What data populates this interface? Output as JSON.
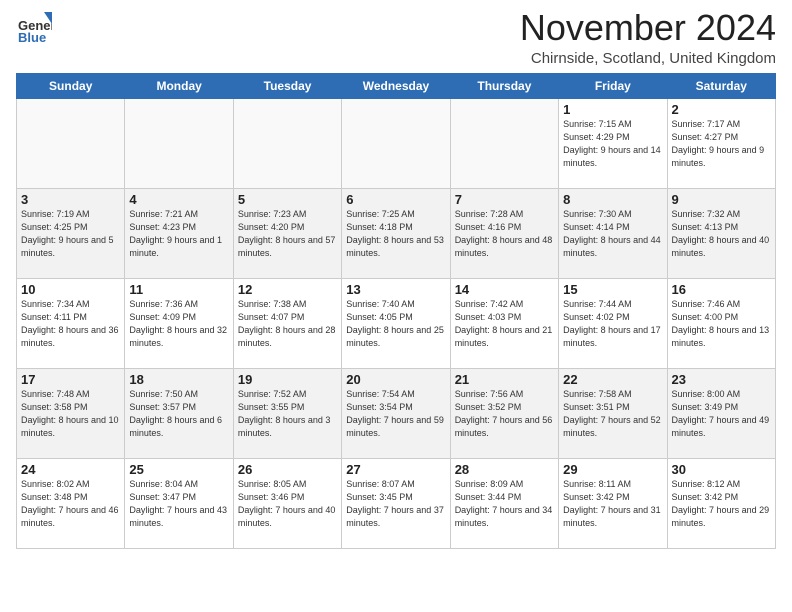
{
  "header": {
    "logo": {
      "general": "General",
      "blue": "Blue"
    },
    "title": "November 2024",
    "location": "Chirnside, Scotland, United Kingdom"
  },
  "weekdays": [
    "Sunday",
    "Monday",
    "Tuesday",
    "Wednesday",
    "Thursday",
    "Friday",
    "Saturday"
  ],
  "weeks": [
    [
      {
        "day": "",
        "empty": true
      },
      {
        "day": "",
        "empty": true
      },
      {
        "day": "",
        "empty": true
      },
      {
        "day": "",
        "empty": true
      },
      {
        "day": "",
        "empty": true
      },
      {
        "day": "1",
        "sunrise": "Sunrise: 7:15 AM",
        "sunset": "Sunset: 4:29 PM",
        "daylight": "Daylight: 9 hours and 14 minutes."
      },
      {
        "day": "2",
        "sunrise": "Sunrise: 7:17 AM",
        "sunset": "Sunset: 4:27 PM",
        "daylight": "Daylight: 9 hours and 9 minutes."
      }
    ],
    [
      {
        "day": "3",
        "sunrise": "Sunrise: 7:19 AM",
        "sunset": "Sunset: 4:25 PM",
        "daylight": "Daylight: 9 hours and 5 minutes."
      },
      {
        "day": "4",
        "sunrise": "Sunrise: 7:21 AM",
        "sunset": "Sunset: 4:23 PM",
        "daylight": "Daylight: 9 hours and 1 minute."
      },
      {
        "day": "5",
        "sunrise": "Sunrise: 7:23 AM",
        "sunset": "Sunset: 4:20 PM",
        "daylight": "Daylight: 8 hours and 57 minutes."
      },
      {
        "day": "6",
        "sunrise": "Sunrise: 7:25 AM",
        "sunset": "Sunset: 4:18 PM",
        "daylight": "Daylight: 8 hours and 53 minutes."
      },
      {
        "day": "7",
        "sunrise": "Sunrise: 7:28 AM",
        "sunset": "Sunset: 4:16 PM",
        "daylight": "Daylight: 8 hours and 48 minutes."
      },
      {
        "day": "8",
        "sunrise": "Sunrise: 7:30 AM",
        "sunset": "Sunset: 4:14 PM",
        "daylight": "Daylight: 8 hours and 44 minutes."
      },
      {
        "day": "9",
        "sunrise": "Sunrise: 7:32 AM",
        "sunset": "Sunset: 4:13 PM",
        "daylight": "Daylight: 8 hours and 40 minutes."
      }
    ],
    [
      {
        "day": "10",
        "sunrise": "Sunrise: 7:34 AM",
        "sunset": "Sunset: 4:11 PM",
        "daylight": "Daylight: 8 hours and 36 minutes."
      },
      {
        "day": "11",
        "sunrise": "Sunrise: 7:36 AM",
        "sunset": "Sunset: 4:09 PM",
        "daylight": "Daylight: 8 hours and 32 minutes."
      },
      {
        "day": "12",
        "sunrise": "Sunrise: 7:38 AM",
        "sunset": "Sunset: 4:07 PM",
        "daylight": "Daylight: 8 hours and 28 minutes."
      },
      {
        "day": "13",
        "sunrise": "Sunrise: 7:40 AM",
        "sunset": "Sunset: 4:05 PM",
        "daylight": "Daylight: 8 hours and 25 minutes."
      },
      {
        "day": "14",
        "sunrise": "Sunrise: 7:42 AM",
        "sunset": "Sunset: 4:03 PM",
        "daylight": "Daylight: 8 hours and 21 minutes."
      },
      {
        "day": "15",
        "sunrise": "Sunrise: 7:44 AM",
        "sunset": "Sunset: 4:02 PM",
        "daylight": "Daylight: 8 hours and 17 minutes."
      },
      {
        "day": "16",
        "sunrise": "Sunrise: 7:46 AM",
        "sunset": "Sunset: 4:00 PM",
        "daylight": "Daylight: 8 hours and 13 minutes."
      }
    ],
    [
      {
        "day": "17",
        "sunrise": "Sunrise: 7:48 AM",
        "sunset": "Sunset: 3:58 PM",
        "daylight": "Daylight: 8 hours and 10 minutes."
      },
      {
        "day": "18",
        "sunrise": "Sunrise: 7:50 AM",
        "sunset": "Sunset: 3:57 PM",
        "daylight": "Daylight: 8 hours and 6 minutes."
      },
      {
        "day": "19",
        "sunrise": "Sunrise: 7:52 AM",
        "sunset": "Sunset: 3:55 PM",
        "daylight": "Daylight: 8 hours and 3 minutes."
      },
      {
        "day": "20",
        "sunrise": "Sunrise: 7:54 AM",
        "sunset": "Sunset: 3:54 PM",
        "daylight": "Daylight: 7 hours and 59 minutes."
      },
      {
        "day": "21",
        "sunrise": "Sunrise: 7:56 AM",
        "sunset": "Sunset: 3:52 PM",
        "daylight": "Daylight: 7 hours and 56 minutes."
      },
      {
        "day": "22",
        "sunrise": "Sunrise: 7:58 AM",
        "sunset": "Sunset: 3:51 PM",
        "daylight": "Daylight: 7 hours and 52 minutes."
      },
      {
        "day": "23",
        "sunrise": "Sunrise: 8:00 AM",
        "sunset": "Sunset: 3:49 PM",
        "daylight": "Daylight: 7 hours and 49 minutes."
      }
    ],
    [
      {
        "day": "24",
        "sunrise": "Sunrise: 8:02 AM",
        "sunset": "Sunset: 3:48 PM",
        "daylight": "Daylight: 7 hours and 46 minutes."
      },
      {
        "day": "25",
        "sunrise": "Sunrise: 8:04 AM",
        "sunset": "Sunset: 3:47 PM",
        "daylight": "Daylight: 7 hours and 43 minutes."
      },
      {
        "day": "26",
        "sunrise": "Sunrise: 8:05 AM",
        "sunset": "Sunset: 3:46 PM",
        "daylight": "Daylight: 7 hours and 40 minutes."
      },
      {
        "day": "27",
        "sunrise": "Sunrise: 8:07 AM",
        "sunset": "Sunset: 3:45 PM",
        "daylight": "Daylight: 7 hours and 37 minutes."
      },
      {
        "day": "28",
        "sunrise": "Sunrise: 8:09 AM",
        "sunset": "Sunset: 3:44 PM",
        "daylight": "Daylight: 7 hours and 34 minutes."
      },
      {
        "day": "29",
        "sunrise": "Sunrise: 8:11 AM",
        "sunset": "Sunset: 3:42 PM",
        "daylight": "Daylight: 7 hours and 31 minutes."
      },
      {
        "day": "30",
        "sunrise": "Sunrise: 8:12 AM",
        "sunset": "Sunset: 3:42 PM",
        "daylight": "Daylight: 7 hours and 29 minutes."
      }
    ]
  ]
}
